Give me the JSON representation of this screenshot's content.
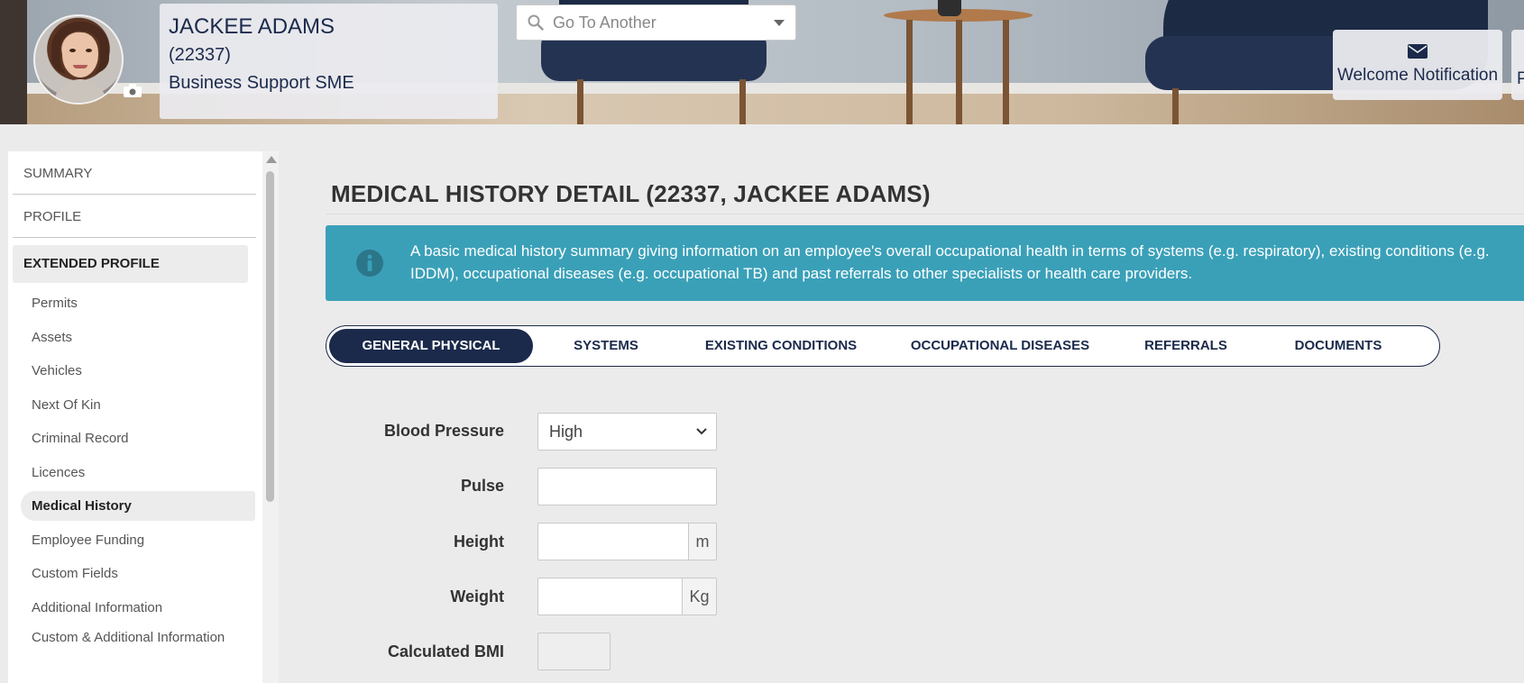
{
  "profile": {
    "name": "JACKEE ADAMS",
    "employee_number": "(22337)",
    "role": "Business Support SME"
  },
  "goto": {
    "placeholder": "Go To Another"
  },
  "header_actions": {
    "welcome_notification": "Welcome Notification",
    "next_partial": "P"
  },
  "sidebar": {
    "sections": [
      "SUMMARY",
      "PROFILE",
      "EXTENDED PROFILE"
    ],
    "active_section": "EXTENDED PROFILE",
    "items": [
      "Permits",
      "Assets",
      "Vehicles",
      "Next Of Kin",
      "Criminal Record",
      "Licences",
      "Medical History",
      "Employee Funding",
      "Custom Fields",
      "Additional Information",
      "Custom & Additional Information"
    ],
    "active_item": "Medical History"
  },
  "main": {
    "title": "MEDICAL HISTORY DETAIL (22337, JACKEE ADAMS)",
    "info_line1": "A basic medical history summary giving information on an employee's overall occupational health in terms of systems (e.g. respiratory), existing conditions (e.g.",
    "info_line2": "IDDM), occupational diseases (e.g. occupational TB) and past referrals to other specialists or health care providers.",
    "tabs": [
      "GENERAL PHYSICAL",
      "SYSTEMS",
      "EXISTING CONDITIONS",
      "OCCUPATIONAL DISEASES",
      "REFERRALS",
      "DOCUMENTS"
    ],
    "active_tab": "GENERAL PHYSICAL"
  },
  "form": {
    "blood_pressure_label": "Blood Pressure",
    "blood_pressure_value": "High",
    "pulse_label": "Pulse",
    "pulse_value": "",
    "height_label": "Height",
    "height_value": "",
    "height_unit": "m",
    "weight_label": "Weight",
    "weight_value": "",
    "weight_unit": "Kg",
    "bmi_label": "Calculated BMI",
    "bmi_value": ""
  },
  "colors": {
    "navy": "#1b2a4b",
    "info_teal": "#3aa0b8",
    "background": "#ebebeb"
  }
}
